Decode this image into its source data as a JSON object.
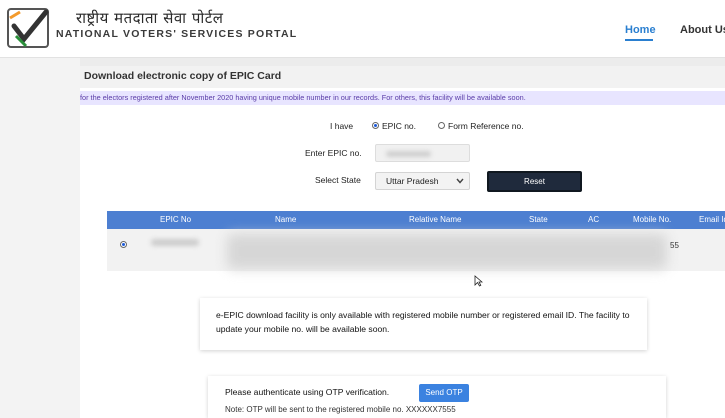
{
  "header": {
    "hindi_title": "राष्ट्रीय मतदाता सेवा पोर्टल",
    "english_title": "NATIONAL VOTERS' SERVICES PORTAL",
    "nav": {
      "home": "Home",
      "about": "About Us"
    },
    "logo_icon": "checkmark-logo-icon"
  },
  "card": {
    "title": "Download electronic copy of EPIC Card",
    "info": "for the electors registered after November 2020 having unique mobile number in our records. For others, this facility will be available soon.",
    "i_have_label": "I have",
    "option_epic": "EPIC no.",
    "option_form": "Form Reference no.",
    "selected_option": "EPIC no.",
    "enter_epic_label": "Enter EPIC no.",
    "select_state_label": "Select State",
    "state_value": "Uttar Pradesh",
    "reset_label": "Reset"
  },
  "table": {
    "headers": [
      "EPIC No",
      "Name",
      "Relative Name",
      "State",
      "AC",
      "Mobile No.",
      "Email Id"
    ],
    "row_mobile_fragment": "55"
  },
  "notice": {
    "text": "e-EPIC download facility is only available with registered mobile number or registered email ID. The facility to update your mobile no. will be available soon."
  },
  "otp": {
    "prompt": "Please authenticate using OTP verification.",
    "button": "Send OTP",
    "note": "Note: OTP will be sent to the registered mobile no. XXXXXX7555"
  },
  "colors": {
    "accent": "#2a7fd0",
    "table_header": "#4d7fd1",
    "reset_button": "#1f2a3c",
    "otp_button": "#3b82e0",
    "info_bar": "#e8e5ff"
  }
}
